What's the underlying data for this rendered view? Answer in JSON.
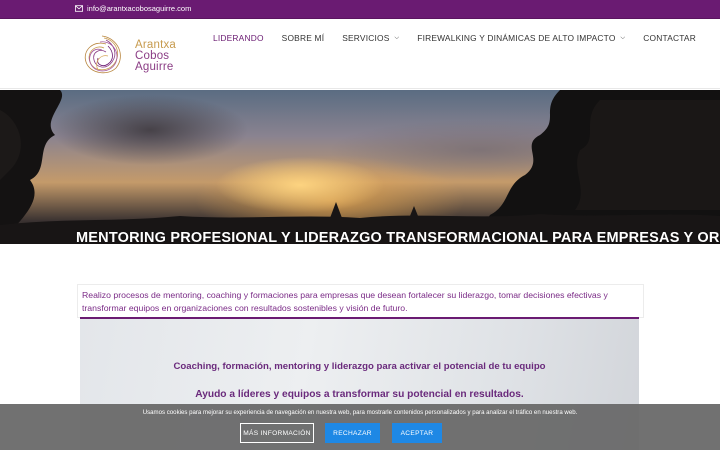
{
  "topbar": {
    "email": "info@arantxacobosaguirre.com",
    "email_icon": "envelope-icon"
  },
  "logo": {
    "line1": "Arantxa",
    "line2": "Cobos",
    "line3": "Aguirre"
  },
  "nav": {
    "items": [
      {
        "label": "LIDERANDO",
        "active": true
      },
      {
        "label": "SOBRE MÍ"
      },
      {
        "label": "SERVICIOS",
        "dropdown": true
      },
      {
        "label": "FIREWALKING Y DINÁMICAS DE ALTO IMPACTO",
        "dropdown": true
      },
      {
        "label": "CONTACTAR"
      }
    ]
  },
  "hero": {
    "title": "MENTORING PROFESIONAL Y LIDERAZGO TRANSFORMACIONAL PARA EMPRESAS Y ORGANIZACIONES"
  },
  "intro": {
    "text": "Realizo procesos de mentoring, coaching y formaciones para empresas que desean fortalecer su liderazgo, tomar decisiones efectivas y transformar equipos en organizaciones con resultados sostenibles y visión de futuro."
  },
  "promo": {
    "line1": "Coaching, formación, mentoring y liderazgo para activar el potencial de tu equipo",
    "line2": "Ayudo a líderes y equipos a transformar su potencial en resultados."
  },
  "cookie": {
    "text": "Usamos cookies para mejorar su experiencia de navegación en nuestra web, para mostrarle contenidos personalizados y para analizar el tráfico en nuestra web.",
    "more_label": "MÁS INFORMACIÓN",
    "reject_label": "RECHAZAR",
    "accept_label": "ACEPTAR"
  },
  "colors": {
    "brand_purple": "#6a1b72",
    "button_blue": "#1e88e5",
    "logo_gold": "#c79b4e"
  }
}
